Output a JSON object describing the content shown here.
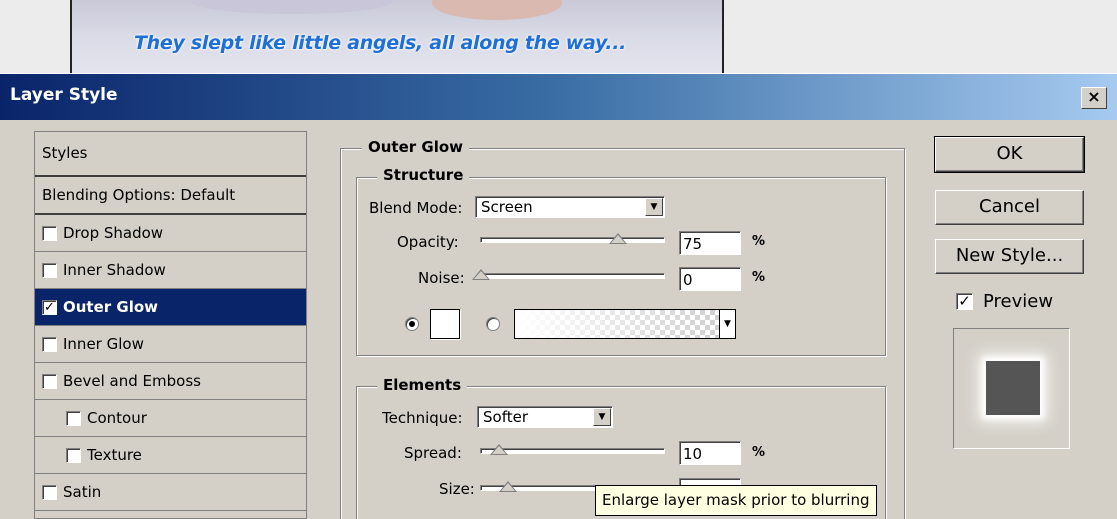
{
  "canvas": {
    "caption": "They slept like little angels, all along the way..."
  },
  "dialog": {
    "title": "Layer Style",
    "close_label": "×"
  },
  "styles_panel": {
    "header": "Styles",
    "blending_options": "Blending Options: Default",
    "items": [
      {
        "label": "Drop Shadow",
        "checked": false,
        "selected": false,
        "indent": false
      },
      {
        "label": "Inner Shadow",
        "checked": false,
        "selected": false,
        "indent": false
      },
      {
        "label": "Outer Glow",
        "checked": true,
        "selected": true,
        "indent": false
      },
      {
        "label": "Inner Glow",
        "checked": false,
        "selected": false,
        "indent": false
      },
      {
        "label": "Bevel and Emboss",
        "checked": false,
        "selected": false,
        "indent": false
      },
      {
        "label": "Contour",
        "checked": false,
        "selected": false,
        "indent": true
      },
      {
        "label": "Texture",
        "checked": false,
        "selected": false,
        "indent": true
      },
      {
        "label": "Satin",
        "checked": false,
        "selected": false,
        "indent": false
      }
    ]
  },
  "outer_glow": {
    "title": "Outer Glow",
    "structure": {
      "title": "Structure",
      "blend_mode_label": "Blend Mode:",
      "blend_mode_value": "Screen",
      "opacity_label": "Opacity:",
      "opacity_value": "75",
      "opacity_level": 75,
      "noise_label": "Noise:",
      "noise_value": "0",
      "noise_level": 0,
      "percent": "%",
      "fill_mode": "color",
      "glow_color": "#ffffff"
    },
    "elements": {
      "title": "Elements",
      "technique_label": "Technique:",
      "technique_value": "Softer",
      "spread_label": "Spread:",
      "spread_value": "10",
      "spread_level": 10,
      "size_label": "Size:",
      "size_level": 15,
      "percent": "%"
    }
  },
  "buttons": {
    "ok": "OK",
    "cancel": "Cancel",
    "new_style": "New Style...",
    "preview_label": "Preview",
    "preview_checked": true
  },
  "tooltip": {
    "text": "Enlarge layer mask prior to blurring"
  },
  "icons": {
    "checkbox": "checkbox-icon",
    "dropdown": "chevron-down-icon",
    "slider": "slider-thumb-icon"
  },
  "colors": {
    "selection": "#0a246a",
    "caption": "#1e6fd6",
    "dialog_bg": "#d4d0c8"
  }
}
